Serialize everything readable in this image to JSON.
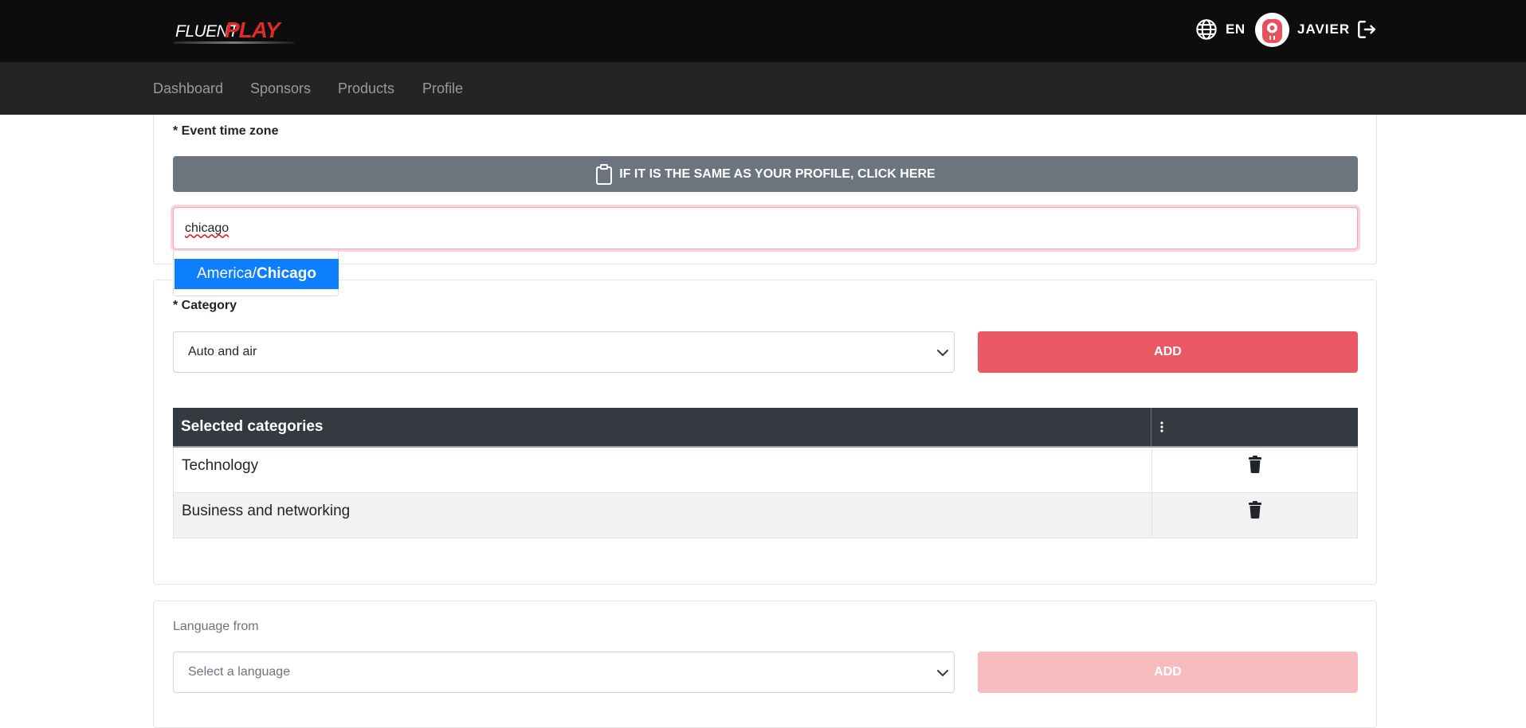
{
  "header": {
    "logo": {
      "text_left": "FLUENT",
      "text_right": "PLAY"
    },
    "language": "EN",
    "user": {
      "name": "JAVIER"
    },
    "icons": {
      "globe": "globe-icon",
      "logout": "logout-icon",
      "avatar": "avatar-icon"
    }
  },
  "nav": {
    "items": [
      {
        "label": "Dashboard"
      },
      {
        "label": "Sponsors"
      },
      {
        "label": "Products"
      },
      {
        "label": "Profile"
      }
    ]
  },
  "timezone": {
    "label": "* Event time zone",
    "profile_button": "IF IT IS THE SAME AS YOUR PROFILE, CLICK HERE",
    "input_value": "chicago",
    "suggestion": {
      "prefix": "America/",
      "match": "Chicago"
    }
  },
  "category": {
    "label": "* Category",
    "selected": "Auto and air",
    "add_label": "ADD",
    "table": {
      "header": "Selected categories",
      "rows": [
        {
          "name": "Technology"
        },
        {
          "name": "Business and networking"
        }
      ]
    }
  },
  "language_from": {
    "label": "Language from",
    "placeholder": "Select a language",
    "add_label": "ADD"
  },
  "colors": {
    "accent": "#ea5863",
    "accent_disabled": "#f6bcc0",
    "highlight": "#0d7efc",
    "secondary": "#6c757d",
    "table_header": "#343a40",
    "topbar": "#0d0d0d",
    "navbar": "#242424"
  }
}
